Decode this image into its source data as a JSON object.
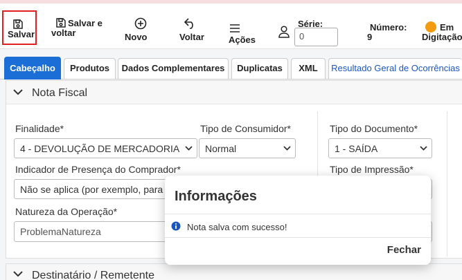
{
  "toolbar": {
    "save_label": "Salvar",
    "save_back_line1": "Salvar e",
    "save_back_line2": "voltar",
    "new_label": "Novo",
    "back_label": "Voltar",
    "actions_label": "Ações",
    "serie_label": "Série:",
    "serie_value": "0",
    "numero_label": "Número:",
    "numero_value": "9",
    "status_line1": "Em",
    "status_line2": "Digitação",
    "status_color": "#f39c12"
  },
  "tabs": [
    {
      "label": "Cabeçalho",
      "active": true
    },
    {
      "label": "Produtos"
    },
    {
      "label": "Dados Complementares"
    },
    {
      "label": "Duplicatas"
    },
    {
      "label": "XML"
    },
    {
      "label": "Resultado Geral de Ocorrências"
    }
  ],
  "section_nota": {
    "title": "Nota Fiscal",
    "finalidade_label": "Finalidade*",
    "finalidade_value": "4 - DEVOLUÇÃO DE MERCADORIA",
    "tipo_consumidor_label": "Tipo de Consumidor*",
    "tipo_consumidor_value": "Normal",
    "tipo_documento_label": "Tipo do Documento*",
    "tipo_documento_value": "1 - SAÍDA",
    "indicador_label": "Indicador de Presença do Comprador*",
    "indicador_value": "Não se aplica (por exemplo, para",
    "tipo_impressao_label": "Tipo de Impressão*",
    "natureza_label": "Natureza da Operação*",
    "natureza_value": "ProblemaNatureza"
  },
  "section_destinatario": {
    "title": "Destinatário / Remetente"
  },
  "modal": {
    "title": "Informações",
    "message": "Nota salva com sucesso!",
    "close_label": "Fechar"
  },
  "colors": {
    "accent": "#1a6ed6",
    "highlight_border": "#e02020"
  }
}
